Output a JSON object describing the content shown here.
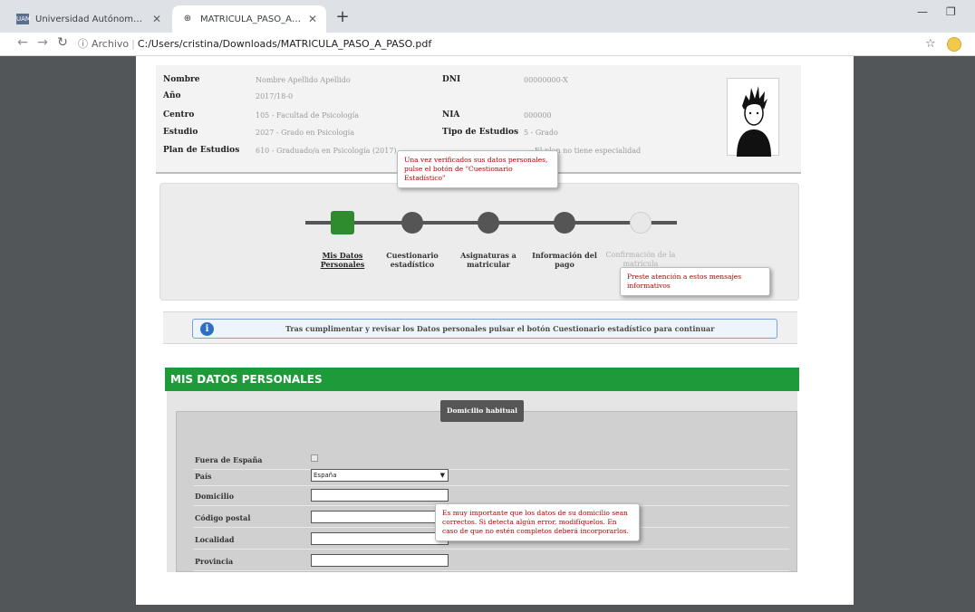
{
  "browser": {
    "tabs": [
      {
        "title": "Universidad Autónoma de Madr",
        "active": false
      },
      {
        "title": "MATRICULA_PASO_A_PASO.pdf",
        "active": true
      }
    ],
    "address_scheme": "Archivo",
    "address_path": "C:/Users/cristina/Downloads/MATRICULA_PASO_A_PASO.pdf"
  },
  "student": {
    "nombre_label": "Nombre",
    "nombre_value": "Nombre Apellido Apellido",
    "dni_label": "DNI",
    "dni_value": "00000000-X",
    "anio_label": "Año",
    "anio_value": "2017/18-0",
    "centro_label": "Centro",
    "centro_value": "105 - Facultad de Psicología",
    "nia_label": "NIA",
    "nia_value": "000000",
    "estudio_label": "Estudio",
    "estudio_value": "2027 - Grado en Psicología",
    "tipo_label": "Tipo de Estudios",
    "tipo_value": "5 - Grado",
    "plan_label": "Plan de Estudios",
    "plan_value": "610 - Graduado/a en Psicología (2017)",
    "especialidad_value": "El plan no tiene especialidad"
  },
  "steps": [
    {
      "label": "Mis Datos Personales",
      "state": "active"
    },
    {
      "label": "Cuestionario estadístico",
      "state": "pending"
    },
    {
      "label": "Asignaturas a matricular",
      "state": "pending"
    },
    {
      "label": "Información del pago",
      "state": "pending"
    },
    {
      "label": "Confirmación de la matrícula",
      "state": "disabled"
    }
  ],
  "tooltips": {
    "cuestionario": "Una vez verificados sus datos personales, pulse el botón de \"Cuestionario Estadístico\"",
    "mensajes": "Preste atención a estos mensajes informativos",
    "domicilio": "Es muy importante que los datos de su domicilio sean correctos. Si detecta algún error, modifíquelos. En caso de que no estén completos deberá incorporarlos."
  },
  "info_message": "Tras cumplimentar y revisar los Datos personales pulsar el botón Cuestionario estadístico para continuar",
  "section_title": "MIS DATOS PERSONALES",
  "form": {
    "tag": "Domicilio habitual",
    "fuera_label": "Fuera de España",
    "pais_label": "País",
    "pais_value": "España",
    "domicilio_label": "Domicilio",
    "cp_label": "Código postal",
    "localidad_label": "Localidad",
    "provincia_label": "Provincia"
  }
}
